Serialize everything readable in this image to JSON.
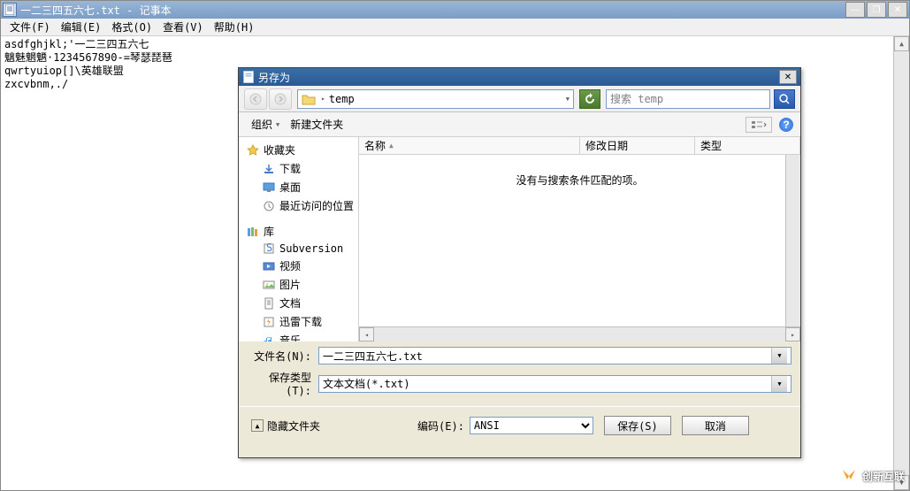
{
  "notepad": {
    "title": "一二三四五六七.txt - 记事本",
    "menu": {
      "file": "文件(F)",
      "edit": "编辑(E)",
      "format": "格式(O)",
      "view": "查看(V)",
      "help": "帮助(H)"
    },
    "content": "asdfghjkl;'一二三四五六七\n魑魅魍魉·1234567890-=琴瑟琵琶\nqwrtyuiop[]\\英雄联盟\nzxcvbnm,./"
  },
  "save_dialog": {
    "title": "另存为",
    "path_label": "temp",
    "path_sep": "▸",
    "search_placeholder": "搜索 temp",
    "toolbar": {
      "organize": "组织",
      "new_folder": "新建文件夹"
    },
    "tree": {
      "favorites": "收藏夹",
      "fav_items": {
        "downloads": "下载",
        "desktop": "桌面",
        "recent": "最近访问的位置"
      },
      "library": "库",
      "lib_items": {
        "subversion": "Subversion",
        "video": "视频",
        "pictures": "图片",
        "documents": "文档",
        "xunlei": "迅雷下载",
        "music": "音乐"
      }
    },
    "columns": {
      "name": "名称",
      "modified": "修改日期",
      "type": "类型"
    },
    "empty_msg": "没有与搜索条件匹配的项。",
    "filename_label": "文件名(N):",
    "filename_value": "一二三四五六七.txt",
    "filetype_label": "保存类型(T):",
    "filetype_value": "文本文档(*.txt)",
    "hide_folders": "隐藏文件夹",
    "encoding_label": "编码(E):",
    "encoding_value": "ANSI",
    "save_btn": "保存(S)",
    "cancel_btn": "取消"
  },
  "watermark": "创新互联"
}
